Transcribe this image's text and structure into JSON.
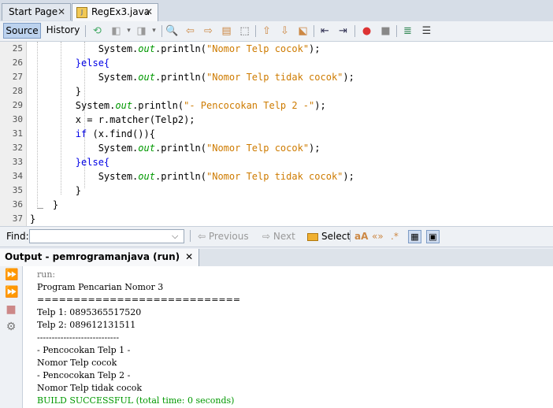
{
  "tabs": [
    {
      "label": "Start Page",
      "active": false
    },
    {
      "label": "RegEx3.java",
      "active": true
    }
  ],
  "toolbar": {
    "source_label": "Source",
    "history_label": "History"
  },
  "editor": {
    "line_numbers": [
      "25",
      "26",
      "27",
      "28",
      "29",
      "30",
      "31",
      "32",
      "33",
      "34",
      "35",
      "36",
      "37"
    ],
    "lines": [
      {
        "pre": "            System.",
        "fld": "out",
        "mid": ".println(",
        "str": "\"Nomor Telp cocok\"",
        "post": ");"
      },
      {
        "kwline": "        }else{"
      },
      {
        "pre": "            System.",
        "fld": "out",
        "mid": ".println(",
        "str": "\"Nomor Telp tidak cocok\"",
        "post": ");"
      },
      {
        "plain": "        }"
      },
      {
        "pre": "        System.",
        "fld": "out",
        "mid": ".println(",
        "str": "\"- Pencocokan Telp 2 -\"",
        "post": ");"
      },
      {
        "plain": "        x = r.matcher(Telp2);"
      },
      {
        "kw": "        if",
        "rest": " (x.find()){"
      },
      {
        "pre": "            System.",
        "fld": "out",
        "mid": ".println(",
        "str": "\"Nomor Telp cocok\"",
        "post": ");"
      },
      {
        "kwline": "        }else{"
      },
      {
        "pre": "            System.",
        "fld": "out",
        "mid": ".println(",
        "str": "\"Nomor Telp tidak cocok\"",
        "post": ");"
      },
      {
        "plain": "        }"
      },
      {
        "plain": "    }"
      },
      {
        "plain": "}"
      }
    ]
  },
  "findbar": {
    "label": "Find:",
    "value": "",
    "previous_label": "Previous",
    "next_label": "Next",
    "select_label": "Select"
  },
  "output": {
    "tab_label": "Output - pemrogramanjava (run)",
    "lines": [
      "run:",
      "Program Pencarian Nomor 3",
      "============================",
      "Telp 1: 0895365517520",
      "Telp 2: 089612131511",
      "----------------------------",
      "- Pencocokan Telp 1 -",
      "Nomor Telp cocok",
      "- Pencocokan Telp 2 -",
      "Nomor Telp tidak cocok",
      "BUILD SUCCESSFUL (total time: 0 seconds)"
    ]
  },
  "colors": {
    "keyword": "#0000e6",
    "field": "#009900",
    "string": "#ce7b00",
    "build_success": "#009900",
    "run_label": "#777777"
  }
}
